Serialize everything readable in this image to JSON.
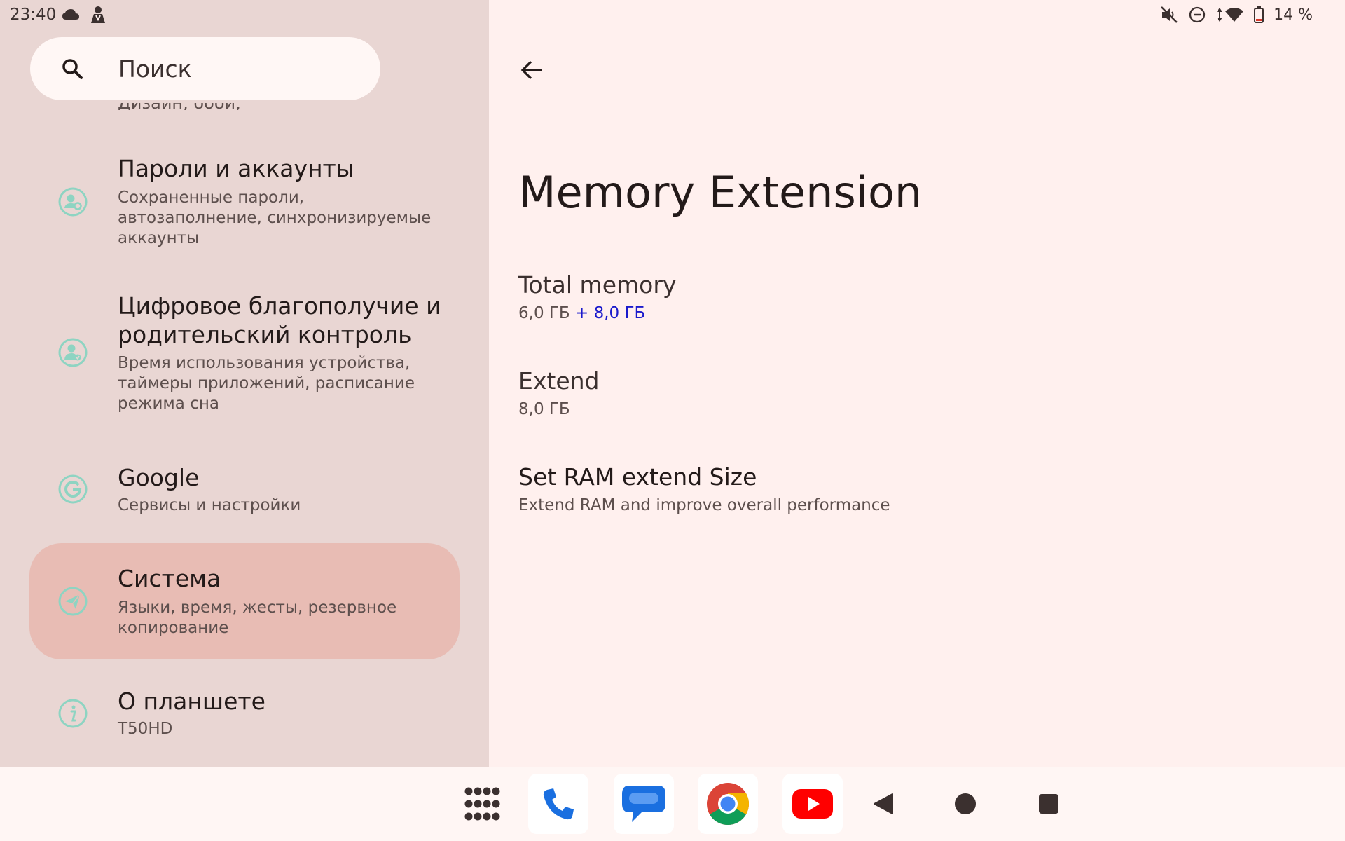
{
  "status_bar": {
    "time": "23:40",
    "battery_percent": "14 %",
    "left_icons": [
      "cloud-icon",
      "spy-icon"
    ],
    "right_icons": [
      "mute-icon",
      "do-not-disturb-icon",
      "data-arrows-icon",
      "wifi-icon",
      "battery-icon"
    ]
  },
  "search": {
    "placeholder": "Поиск"
  },
  "settings_list": {
    "cutoff_text": "Дизайн, обои, стиль",
    "items": [
      {
        "title": "Пароли и аккаунты",
        "subtitle_lines": [
          "Сохраненные пароли,",
          "автозаполнение, синхронизируемые",
          "аккаунты"
        ],
        "icon": "account-key-icon",
        "selected": false
      },
      {
        "title_lines": [
          "Цифровое благополучие и",
          "родительский контроль"
        ],
        "subtitle_lines": [
          "Время использования устройства,",
          "таймеры приложений, расписание",
          "режима сна"
        ],
        "icon": "wellbeing-person-icon",
        "selected": false
      },
      {
        "title": "Google",
        "subtitle_lines": [
          "Сервисы и настройки"
        ],
        "icon": "google-g-icon",
        "selected": false
      },
      {
        "title": "Система",
        "subtitle_lines": [
          "Языки, время, жесты, резервное",
          "копирование"
        ],
        "icon": "system-send-icon",
        "selected": true
      },
      {
        "title": "О планшете",
        "subtitle_lines": [
          "T50HD"
        ],
        "icon": "info-icon",
        "selected": false
      }
    ]
  },
  "detail": {
    "title": "Memory Extension",
    "total_memory": {
      "label": "Total memory",
      "base": "6,0 ГБ",
      "extra": "+ 8,0 ГБ"
    },
    "extend": {
      "label": "Extend",
      "value": "8,0 ГБ"
    },
    "set_ram": {
      "label": "Set RAM extend Size",
      "summary": "Extend RAM and improve overall performance"
    }
  },
  "navigation_bar": {
    "dock": [
      "app-drawer-icon",
      "phone-icon",
      "messages-icon",
      "chrome-icon",
      "youtube-icon"
    ],
    "system_buttons": [
      "back-triangle-icon",
      "home-circle-icon",
      "recents-square-icon"
    ]
  },
  "colors": {
    "left_pane_bg": "#e9d6d3",
    "right_pane_bg": "#fff0ee",
    "selected_item_bg": "#e8bcb4",
    "icon_tint": "#8ed4c2",
    "accent_blue": "#1a1acc"
  }
}
